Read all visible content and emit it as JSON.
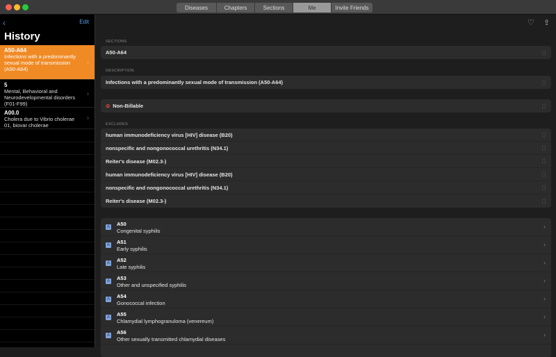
{
  "toolbar": {
    "tabs": [
      "Diseases",
      "Chapters",
      "Sections",
      "Me",
      "Invite Friends"
    ],
    "active": "Me"
  },
  "sidebar": {
    "edit": "Edit",
    "title": "History",
    "items": [
      {
        "code": "A50-A64",
        "desc": "Infections with a predominantly sexual mode of transmission (A50-A64)"
      },
      {
        "code": "5",
        "desc": "Mental, Behavioral and Neurodevelopmental disorders (F01-F99)"
      },
      {
        "code": "A00.0",
        "desc": "Cholera due to Vibrio cholerae 01, biovar cholerae"
      }
    ]
  },
  "main": {
    "sections_label": "SECTIONS",
    "sections_value": "A50-A64",
    "description_label": "DESCRIPTION",
    "description_value": "Infections with a predominantly sexual mode of transmission (A50-A64)",
    "billable": "Non-Billable",
    "excludes_label": "EXCLUDES",
    "excludes": [
      "human immunodeficiency virus [HIV] disease (B20)",
      "nonspecific and nongonococcal urethritis (N34.1)",
      "Reiter's disease (M02.3-)",
      "human immunodeficiency virus [HIV] disease (B20)",
      "nonspecific and nongonococcal urethritis (N34.1)",
      "Reiter's disease (M02.3-)"
    ],
    "badge": "A",
    "codes": [
      {
        "code": "A50",
        "desc": "Congenital syphilis"
      },
      {
        "code": "A51",
        "desc": "Early syphilis"
      },
      {
        "code": "A52",
        "desc": "Late syphilis"
      },
      {
        "code": "A53",
        "desc": "Other and unspecified syphilis"
      },
      {
        "code": "A54",
        "desc": "Gonococcal infection"
      },
      {
        "code": "A55",
        "desc": "Chlamydial lymphogranuloma (venereum)"
      },
      {
        "code": "A56",
        "desc": "Other sexually transmitted chlamydial diseases"
      }
    ]
  }
}
